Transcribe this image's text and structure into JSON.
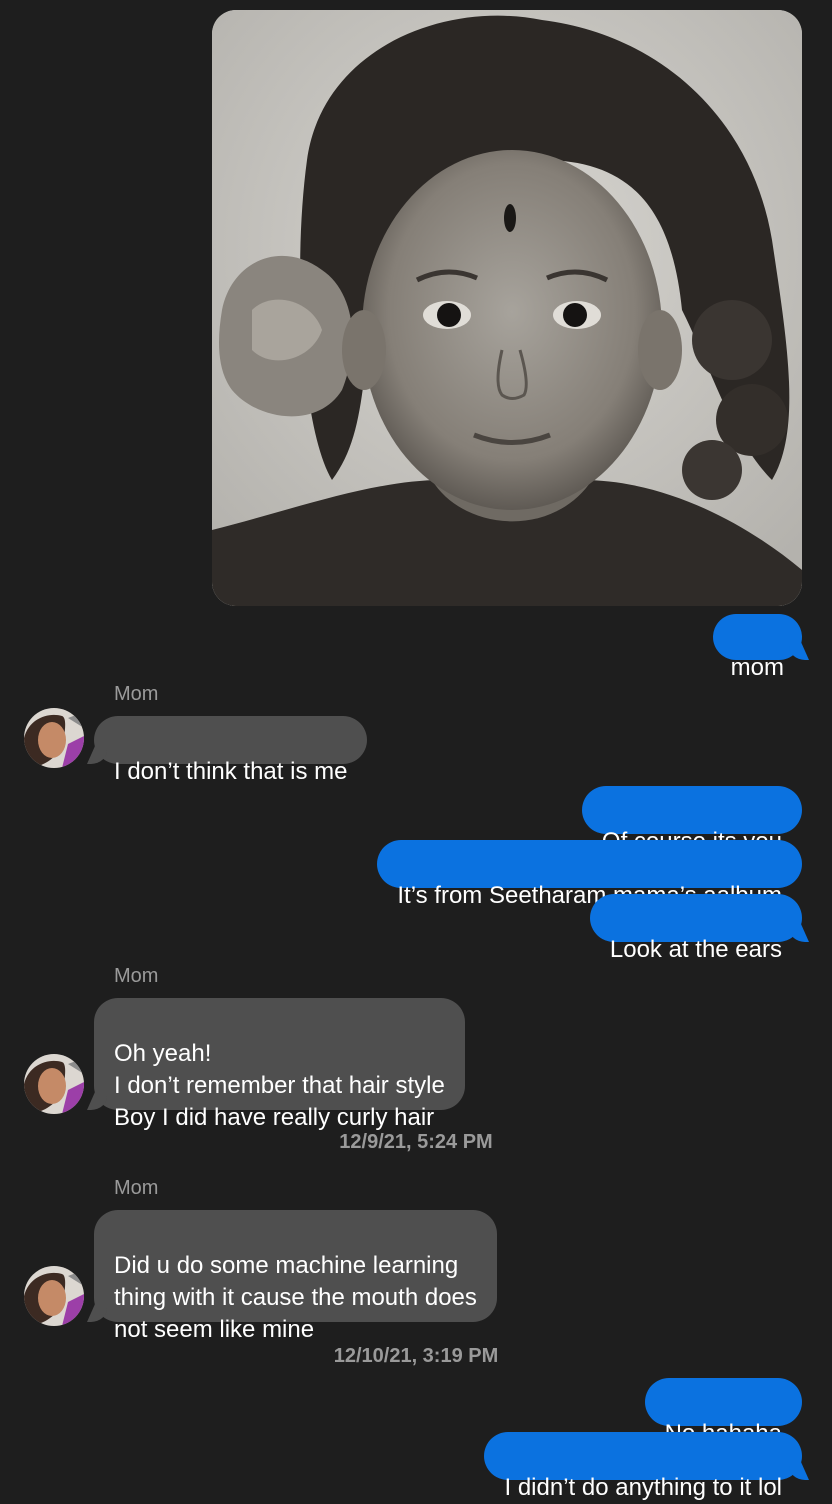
{
  "colors": {
    "background": "#1e1e1e",
    "outgoing_bubble": "#0b72e0",
    "incoming_bubble": "#4f4f4f",
    "secondary_text": "#9a9a9a"
  },
  "messages": [
    {
      "direction": "out",
      "type": "image"
    },
    {
      "direction": "out",
      "text": "mom"
    },
    {
      "direction": "in",
      "sender": "Mom",
      "text": "I don’t think that is me"
    },
    {
      "direction": "out",
      "text": "Of course its you"
    },
    {
      "direction": "out",
      "text": "It’s from Seetharam mama’s aalbum"
    },
    {
      "direction": "out",
      "text": "Look at the ears"
    },
    {
      "direction": "in",
      "sender": "Mom",
      "text": "Oh yeah!\nI don’t remember that hair style\nBoy I did have really curly hair"
    },
    {
      "timestamp": "12/9/21, 5:24 PM"
    },
    {
      "direction": "in",
      "sender": "Mom",
      "text": "Did u do some machine learning\nthing with it cause the mouth does\nnot seem like mine"
    },
    {
      "timestamp": "12/10/21, 3:19 PM"
    },
    {
      "direction": "out",
      "text": "No hahaha"
    },
    {
      "direction": "out",
      "text": "I didn’t do anything to it lol"
    }
  ]
}
